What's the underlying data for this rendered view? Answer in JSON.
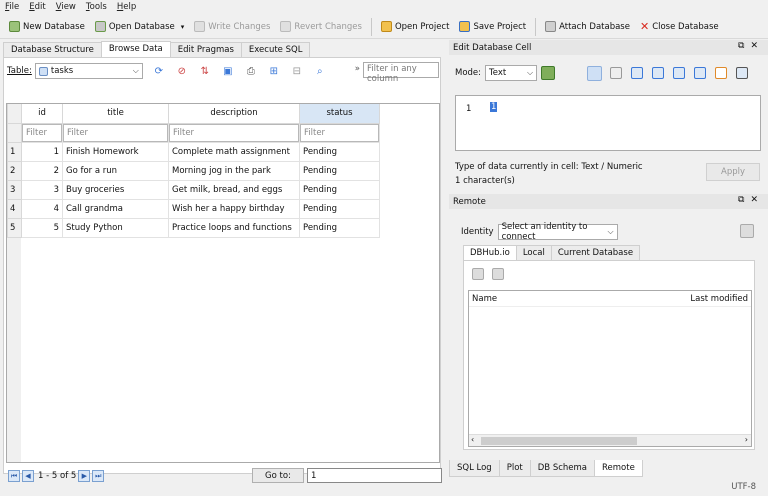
{
  "menu": [
    "File",
    "Edit",
    "View",
    "Tools",
    "Help"
  ],
  "toolbar": {
    "new_db": "New Database",
    "open_db": "Open Database",
    "write": "Write Changes",
    "revert": "Revert Changes",
    "open_project": "Open Project",
    "save_project": "Save Project",
    "attach_db": "Attach Database",
    "close_db": "Close Database"
  },
  "tabs": [
    "Database Structure",
    "Browse Data",
    "Edit Pragmas",
    "Execute SQL"
  ],
  "browse": {
    "table_label": "Table:",
    "table_name": "tasks",
    "filter_all_placeholder": "Filter in any column",
    "filter_placeholder": "Filter",
    "columns": [
      "id",
      "title",
      "description",
      "status"
    ],
    "rows": [
      {
        "rn": "1",
        "id": "1",
        "title": "Finish Homework",
        "description": "Complete math assignment",
        "status": "Pending"
      },
      {
        "rn": "2",
        "id": "2",
        "title": "Go for a run",
        "description": "Morning jog in the park",
        "status": "Pending"
      },
      {
        "rn": "3",
        "id": "3",
        "title": "Buy groceries",
        "description": "Get milk, bread, and eggs",
        "status": "Pending"
      },
      {
        "rn": "4",
        "id": "4",
        "title": "Call grandma",
        "description": "Wish her a happy birthday",
        "status": "Pending"
      },
      {
        "rn": "5",
        "id": "5",
        "title": "Study Python",
        "description": "Practice loops and functions",
        "status": "Pending"
      }
    ],
    "page_info": "1 - 5 of 5",
    "goto_label": "Go to:",
    "goto_value": "1"
  },
  "edit_cell": {
    "title": "Edit Database Cell",
    "mode_label": "Mode:",
    "mode_value": "Text",
    "line_no": "1",
    "value": "1",
    "type_info": "Type of data currently in cell: Text / Numeric",
    "size_info": "1 character(s)",
    "apply": "Apply"
  },
  "remote": {
    "title": "Remote",
    "identity_label": "Identity",
    "identity_value": "Select an identity to connect",
    "tabs": [
      "DBHub.io",
      "Local",
      "Current Database"
    ],
    "col_name": "Name",
    "col_modified": "Last modified"
  },
  "bottom_tabs": [
    "SQL Log",
    "Plot",
    "DB Schema",
    "Remote"
  ],
  "status": "UTF-8",
  "colors": {
    "accent": "#3b78d8",
    "sorted_header": "#d8e6f5"
  }
}
